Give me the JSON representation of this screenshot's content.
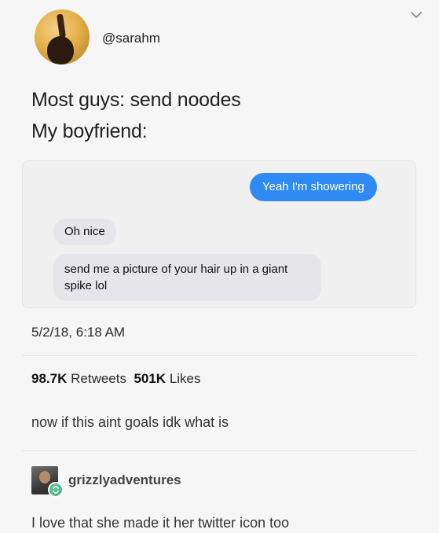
{
  "tweet": {
    "handle": "@sarahm",
    "text_line1": "Most guys: send noodes",
    "text_line2": "My boyfriend:",
    "timestamp": "5/2/18, 6:18 AM"
  },
  "messages": {
    "sent": "Yeah I'm showering",
    "received_1": "Oh nice",
    "received_2": "send me a picture of your hair up in a giant spike lol"
  },
  "stats": {
    "retweets_count": "98.7K",
    "retweets_label": "Retweets",
    "likes_count": "501K",
    "likes_label": "Likes"
  },
  "reblogs": [
    {
      "text": "now if this aint goals idk what is"
    },
    {
      "username": "grizzlyadventures",
      "text": "I love that she made it her twitter icon too"
    }
  ],
  "icons": {
    "chevron": "chevron-down-icon",
    "reblog": "reblog-icon"
  },
  "colors": {
    "imessage_blue": "#2f8af3",
    "bubble_gray": "#e5e5ea",
    "reblog_green": "#56bc8a"
  }
}
